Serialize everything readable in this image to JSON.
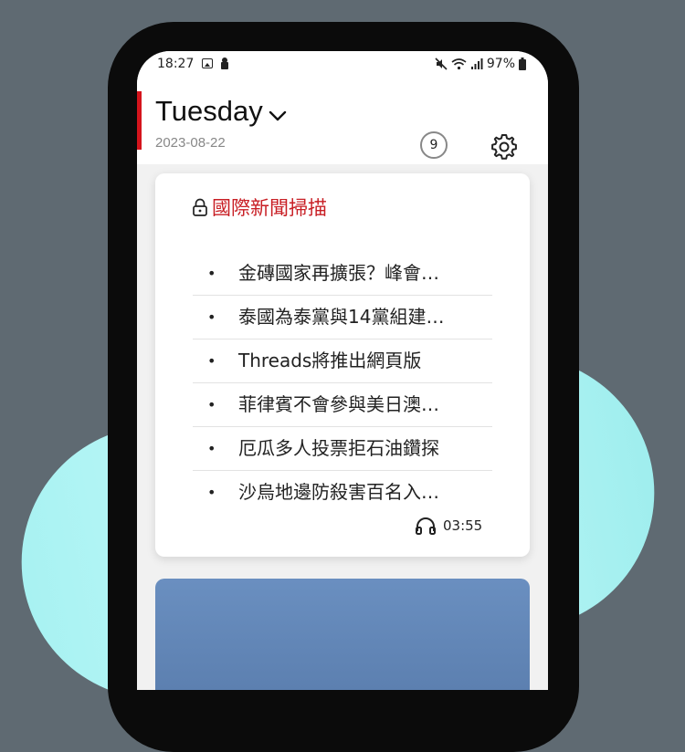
{
  "status_bar": {
    "time": "18:27",
    "battery": "97%",
    "icons": [
      "photo-icon",
      "lock-icon",
      "mute-icon",
      "wifi-icon",
      "signal-icon",
      "battery-icon"
    ]
  },
  "header": {
    "day": "Tuesday",
    "date": "2023-08-22",
    "count": "9",
    "accent_color": "#d4141c"
  },
  "news_card": {
    "title": "國際新聞掃描",
    "title_color": "#c81e24",
    "items": [
      "金磚國家再擴張？峰會…",
      "泰國為泰黨與14黨組建…",
      "Threads將推出網頁版",
      "菲律賓不會參與美日澳…",
      "厄瓜多人投票拒石油鑽探",
      "沙烏地邊防殺害百名入…"
    ],
    "duration": "03:55"
  },
  "colors": {
    "background": "#5f6a72",
    "pill": "#b4f6f6",
    "card2": "#6a8fc0"
  }
}
